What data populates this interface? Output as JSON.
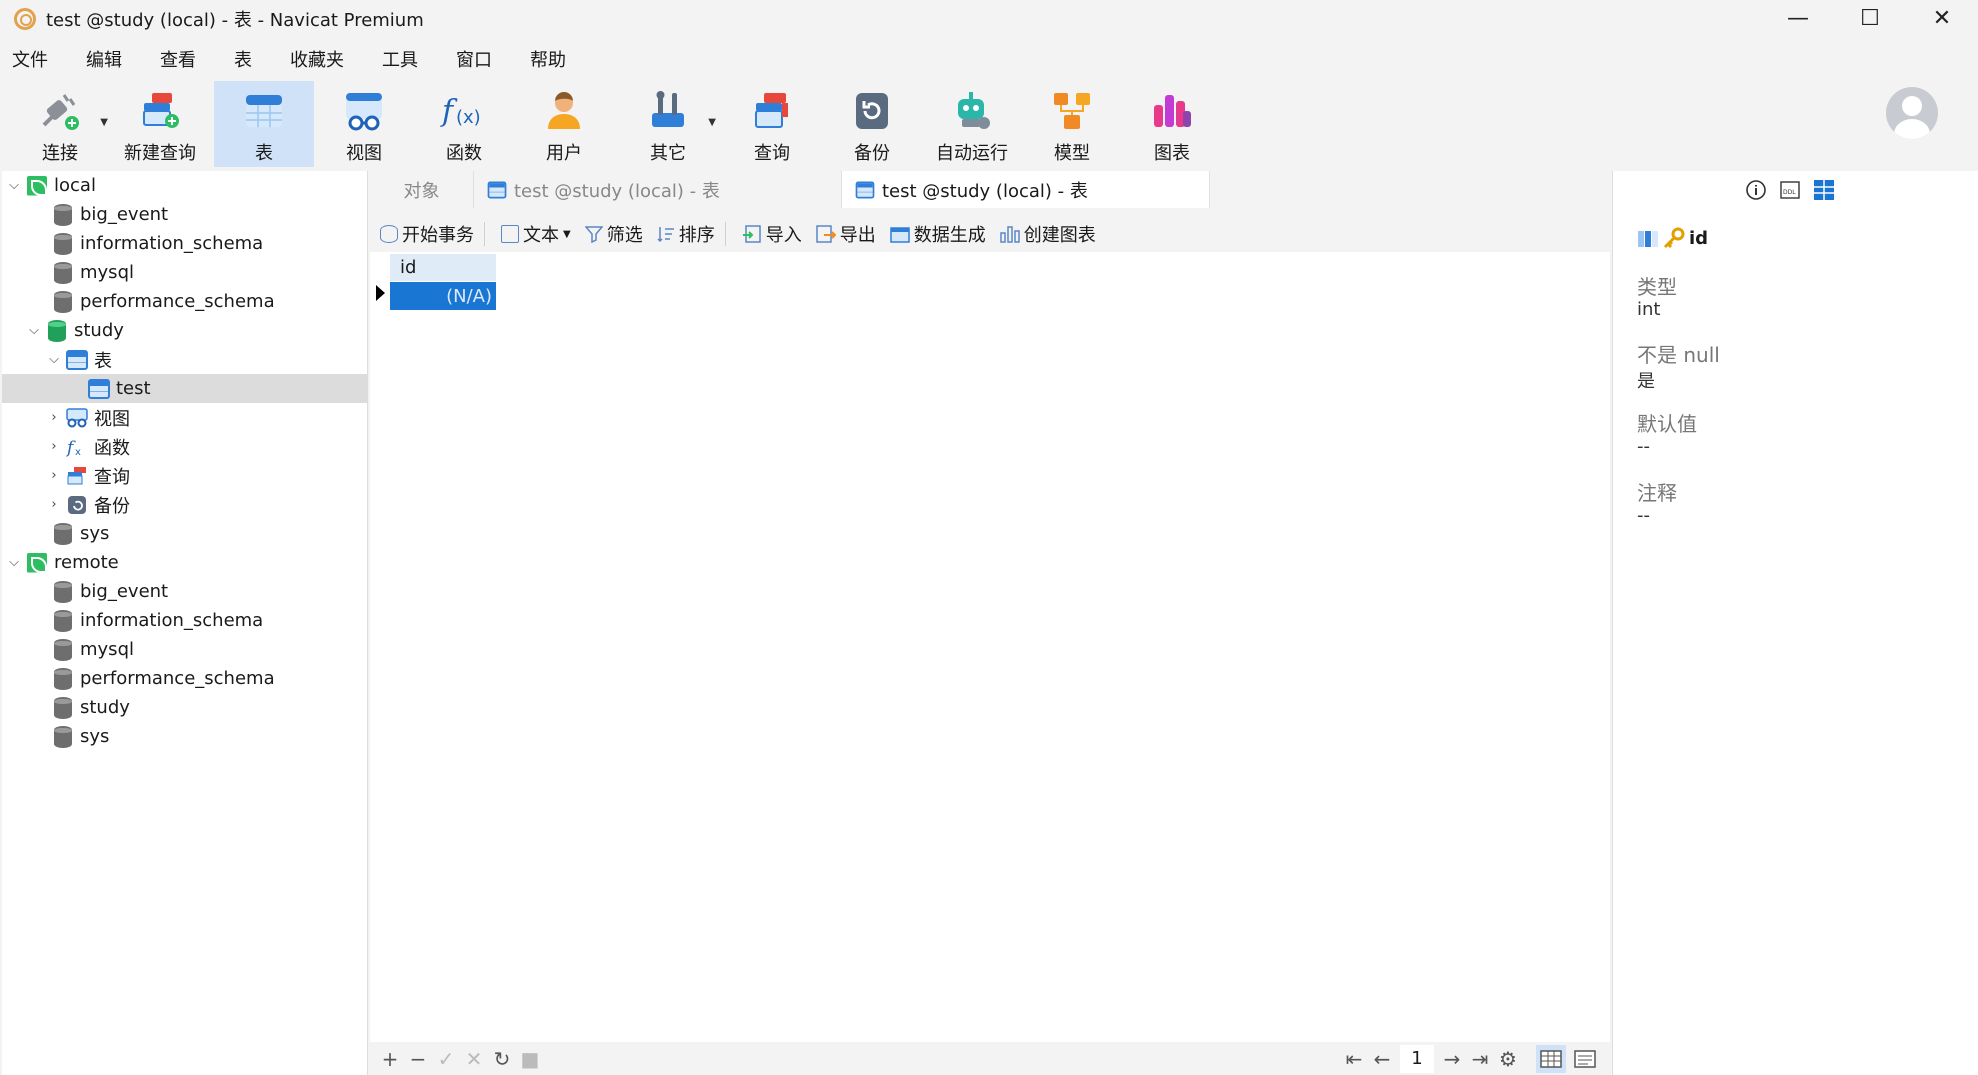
{
  "window": {
    "title": "test @study (local) - 表 - Navicat Premium",
    "controls": {
      "minimize": "—",
      "maximize": "☐",
      "close": "✕"
    }
  },
  "menu": [
    "文件",
    "编辑",
    "查看",
    "表",
    "收藏夹",
    "工具",
    "窗口",
    "帮助"
  ],
  "toolbar": {
    "connect": "连接",
    "new_query": "新建查询",
    "table": "表",
    "view": "视图",
    "function": "函数",
    "user": "用户",
    "other": "其它",
    "query": "查询",
    "backup": "备份",
    "automation": "自动运行",
    "model": "模型",
    "chart": "图表"
  },
  "tree": {
    "local": {
      "name": "local",
      "databases": [
        "big_event",
        "information_schema",
        "mysql",
        "performance_schema"
      ],
      "study": {
        "name": "study",
        "tables_label": "表",
        "tables": [
          "test"
        ],
        "views_label": "视图",
        "functions_label": "函数",
        "queries_label": "查询",
        "backups_label": "备份"
      },
      "sys": "sys"
    },
    "remote": {
      "name": "remote",
      "databases": [
        "big_event",
        "information_schema",
        "mysql",
        "performance_schema",
        "study",
        "sys"
      ]
    }
  },
  "tabs": [
    "对象",
    "test @study (local) - 表",
    "test @study (local) - 表"
  ],
  "subtoolbar": {
    "begin_tx": "开始事务",
    "text": "文本",
    "filter": "筛选",
    "sort": "排序",
    "import": "导入",
    "export": "导出",
    "data_gen": "数据生成",
    "create_chart": "创建图表"
  },
  "grid": {
    "columns": [
      "id"
    ],
    "rows": [
      [
        "(N/A)"
      ]
    ]
  },
  "pager": {
    "page": "1"
  },
  "details": {
    "field_name": "id",
    "type_label": "类型",
    "type_value": "int",
    "notnull_label": "不是 null",
    "notnull_value": "是",
    "default_label": "默认值",
    "default_value": "--",
    "comment_label": "注释",
    "comment_value": "--"
  },
  "colors": {
    "accent": "#1976d2",
    "selected_tab": "#cfe2f7",
    "db_green": "#21a05a"
  }
}
